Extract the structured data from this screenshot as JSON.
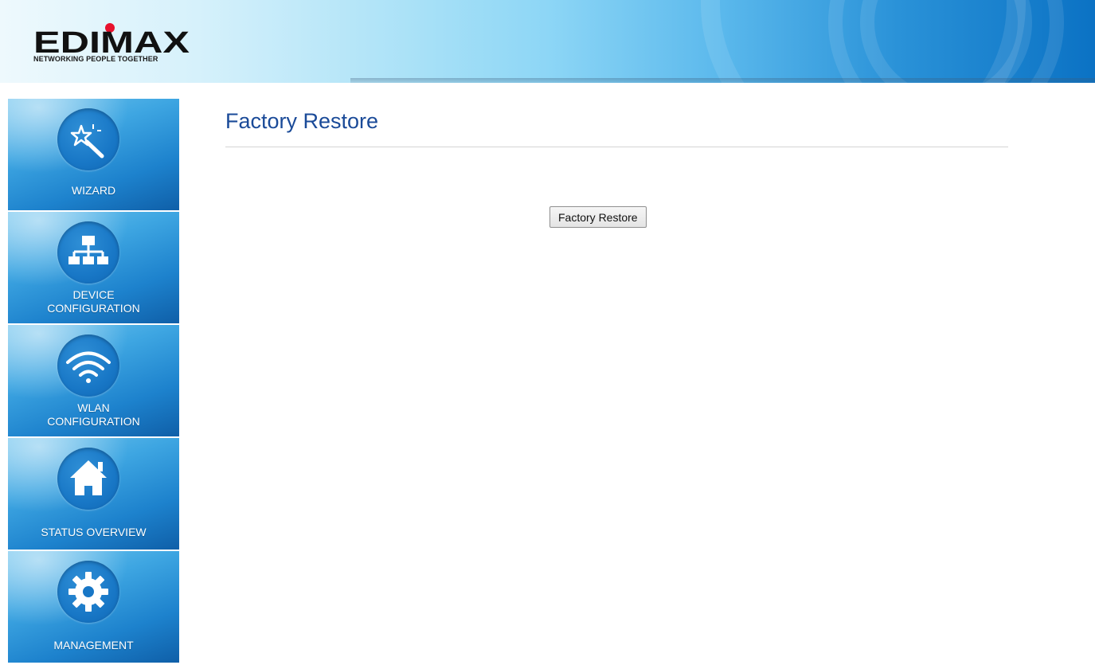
{
  "brand": {
    "logo_text": "EDIMAX",
    "tagline": "NETWORKING PEOPLE TOGETHER"
  },
  "sidebar": {
    "items": [
      {
        "label": "WIZARD",
        "icon": "magic-wand-icon"
      },
      {
        "label": "DEVICE\nCONFIGURATION",
        "icon": "network-icon"
      },
      {
        "label": "WLAN\nCONFIGURATION",
        "icon": "wifi-icon"
      },
      {
        "label": "STATUS OVERVIEW",
        "icon": "home-icon"
      },
      {
        "label": "MANAGEMENT",
        "icon": "gear-icon"
      }
    ]
  },
  "main": {
    "title": "Factory Restore",
    "restore_button_label": "Factory Restore"
  },
  "colors": {
    "title": "#1a4a98",
    "accent_dot": "#e8112d",
    "sidebar_blue": "#1d82cd"
  }
}
